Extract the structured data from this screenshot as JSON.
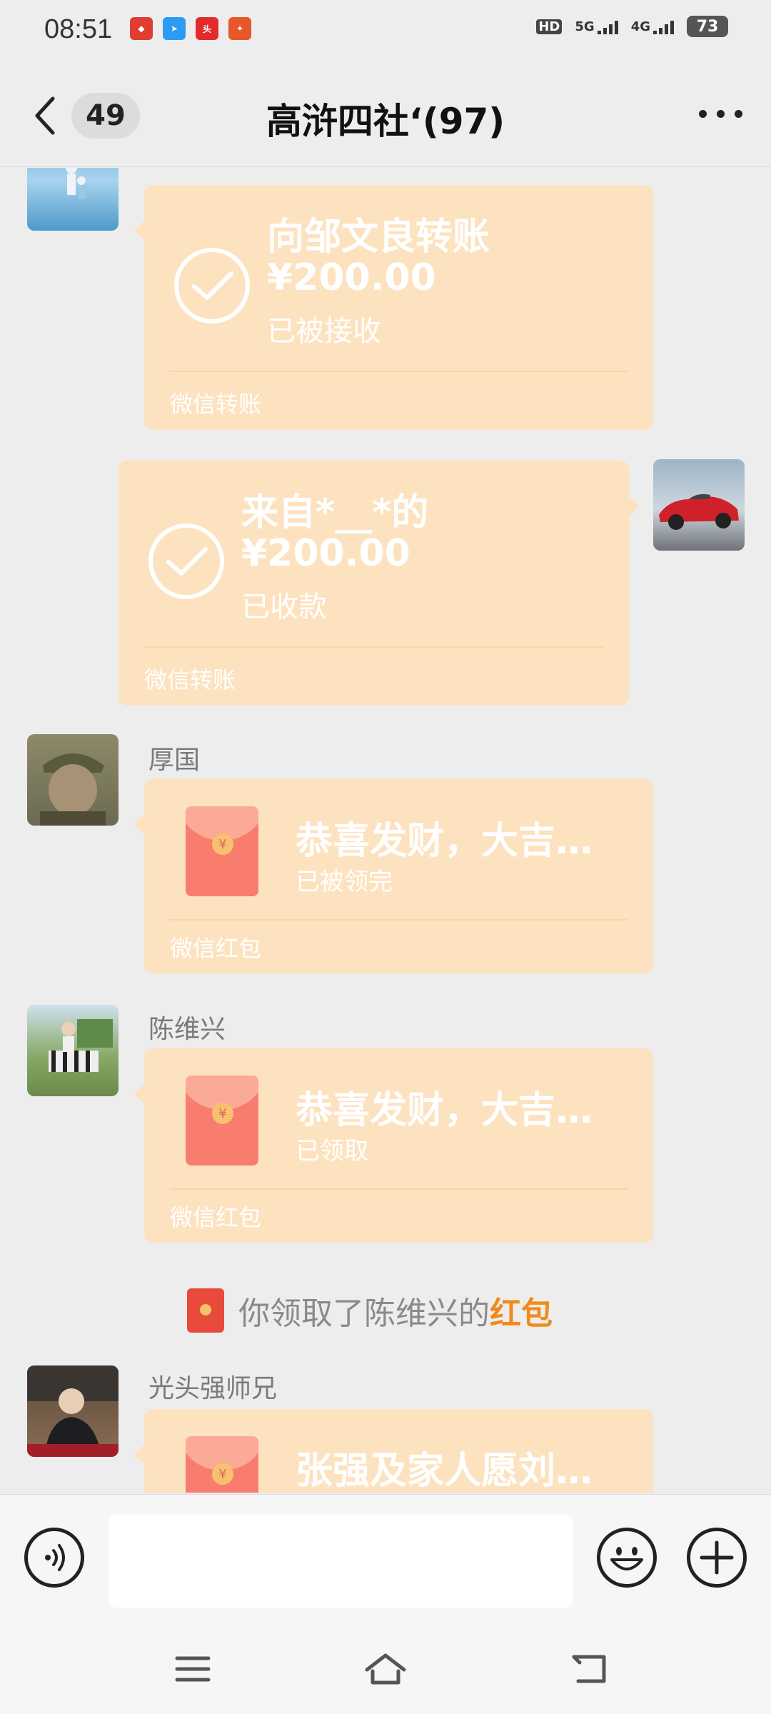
{
  "status_bar": {
    "time": "08:51",
    "network_1": "HD",
    "network_2": "5G",
    "network_3": "4G",
    "battery": "73",
    "notification_apps": [
      "app-notification-icon",
      "telegram-like-icon",
      "toutiao-icon",
      "app-icon"
    ],
    "colors": {
      "app1": "#e03c31",
      "app2": "#2b9bf4",
      "app3": "#e32b2b",
      "app4": "#e8572a"
    }
  },
  "header": {
    "unread_count": "49",
    "title": "高浒四社‘(97)"
  },
  "messages": [
    {
      "type": "transfer",
      "direction": "incoming",
      "sender": "",
      "title": "向邹文良转账",
      "amount": "¥200.00",
      "status": "已被接收",
      "footer": "微信转账"
    },
    {
      "type": "transfer",
      "direction": "outgoing",
      "title": "来自*__*的",
      "amount": "¥200.00",
      "status": "已收款",
      "footer": "微信转账"
    },
    {
      "type": "red_packet",
      "direction": "incoming",
      "sender": "厚国",
      "greeting": "恭喜发财，大吉…",
      "status": "已被领完",
      "footer": "微信红包"
    },
    {
      "type": "red_packet",
      "direction": "incoming",
      "sender": "陈维兴",
      "greeting": "恭喜发财，大吉…",
      "status": "已领取",
      "footer": "微信红包"
    },
    {
      "type": "red_packet",
      "direction": "incoming",
      "sender": "光头强师兄",
      "greeting": "张强及家人愿刘…"
    }
  ],
  "system_message": {
    "text": "你领取了陈维兴的",
    "link": "红包"
  },
  "input_bar": {
    "placeholder": ""
  },
  "colors": {
    "card_bg": "#fde2c0",
    "envelope": "#f97d6e",
    "link": "#f08b1b",
    "background": "#ededed"
  }
}
